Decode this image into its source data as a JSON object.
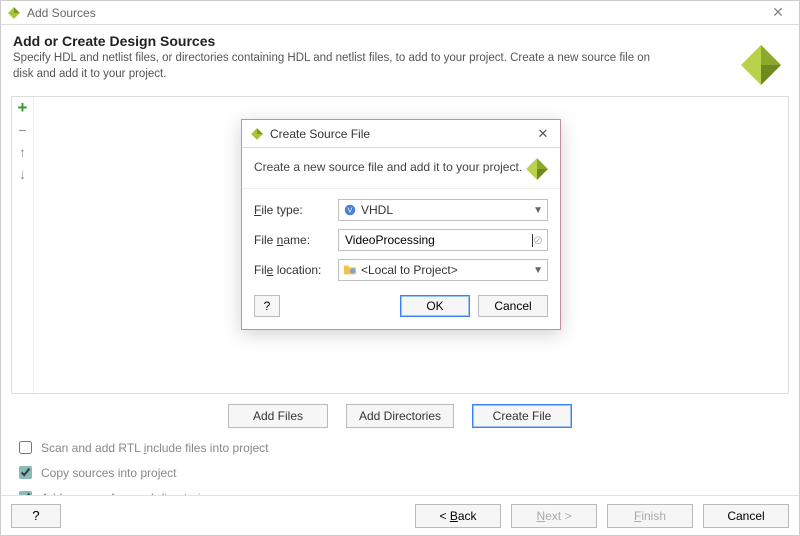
{
  "window": {
    "title": "Add Sources",
    "header_title": "Add or Create Design Sources",
    "header_desc": "Specify HDL and netlist files, or directories containing HDL and netlist files, to add to your project. Create a new source file on disk and add it to your project."
  },
  "side_tools": {
    "add": "+",
    "remove": "−",
    "up": "↑",
    "down": "↓"
  },
  "mid_buttons": {
    "add_files": "Add Files",
    "add_dirs": "Add Directories",
    "create_file": "Create File"
  },
  "options": {
    "scan_label_pre": "Scan and add RTL ",
    "scan_label_u": "i",
    "scan_label_post": "nclude files into project",
    "scan_checked": false,
    "copy_label": "Copy sources into project",
    "copy_checked": true,
    "subdirs_label": "Add sources from subdirectories",
    "subdirs_checked": true
  },
  "footer": {
    "help": "?",
    "back_pre": "< ",
    "back_u": "B",
    "back_post": "ack",
    "next_u": "N",
    "next_post": "ext >",
    "finish_u": "F",
    "finish_post": "inish",
    "cancel": "Cancel"
  },
  "modal": {
    "title": "Create Source File",
    "desc": "Create a new source file and add it to your project.",
    "file_type_label_u": "F",
    "file_type_label_post": "ile type:",
    "file_type_value": "VHDL",
    "file_name_label_pre": "File ",
    "file_name_label_u": "n",
    "file_name_label_post": "ame:",
    "file_name_value": "VideoProcessing",
    "file_loc_label_pre": "Fil",
    "file_loc_label_u": "e",
    "file_loc_label_post": " location:",
    "file_loc_value": "<Local to Project>",
    "help": "?",
    "ok": "OK",
    "cancel": "Cancel"
  }
}
